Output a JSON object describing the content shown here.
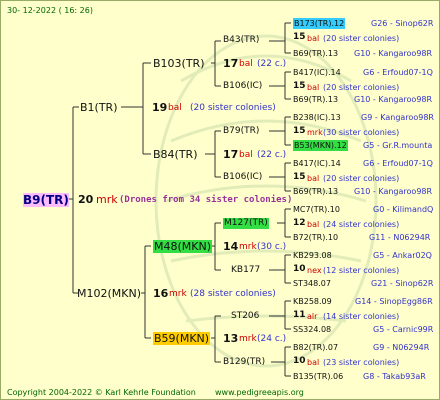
{
  "header": {
    "date": "30- 12-2022 ( 16: 26)"
  },
  "footer": {
    "copyright": "Copyright 2004-2022 © Karl Kehrle Foundation",
    "site": "www.pedigreeapis.org"
  },
  "colors": {
    "background": "#ffffcc",
    "highlight_cyan": "#33ccff",
    "highlight_green": "#33dd44",
    "highlight_yellow": "#ffcc00",
    "highlight_pink": "#ffbbff"
  },
  "root": {
    "name": "B9(TR)",
    "drones_count": "20",
    "drones_unit": "mrk",
    "drones_note": "(Drones from 34 sister colonies)"
  },
  "gen2": [
    {
      "name": "B1(TR)",
      "count": "19",
      "unit": "bal",
      "note": "(20 sister colonies)"
    },
    {
      "name": "M102(MKN)",
      "count": "16",
      "unit": "mrk",
      "note": "(28 sister colonies)"
    }
  ],
  "gen3": [
    {
      "name": "B103(TR)",
      "count": "17",
      "unit": "bal",
      "note": "(22 c.)",
      "mother": "B43(TR)",
      "father": "B106(IC)"
    },
    {
      "name": "B84(TR)",
      "count": "17",
      "unit": "bal",
      "note": "(22 c.)",
      "mother": "B79(TR)",
      "father": "B106(IC)"
    },
    {
      "name": "M48(MKN)",
      "count": "14",
      "unit": "mrk",
      "note": "(30 c.)",
      "mother": "M127(TR)",
      "father": "KB177"
    },
    {
      "name": "B59(MKN)",
      "count": "13",
      "unit": "mrk",
      "note": "(24 c.)",
      "mother": "ST206",
      "father": "B129(TR)"
    }
  ],
  "gen5": [
    {
      "queen": "B173(TR).12",
      "info": "G26 - Sinop62R",
      "count": "15",
      "unit": "bal",
      "note": "(20 sister colonies)",
      "drone": "B69(TR).13",
      "drone_info": "G10 - Kangaroo98R"
    },
    {
      "queen": "B417(IC).14",
      "info": "G6 - Erfoud07-1Q",
      "count": "15",
      "unit": "bal",
      "note": "(20 sister colonies)",
      "drone": "B69(TR).13",
      "drone_info": "G10 - Kangaroo98R"
    },
    {
      "queen": "B238(IC).13",
      "info": "G9 - Kangaroo98R",
      "count": "15",
      "unit": "mrk",
      "note": "(30 sister colonies)",
      "drone": "B53(MKN).12",
      "drone_info": "G5 - Gr.R.mounta"
    },
    {
      "queen": "B417(IC).14",
      "info": "G6 - Erfoud07-1Q",
      "count": "15",
      "unit": "bal",
      "note": "(20 sister colonies)",
      "drone": "B69(TR).13",
      "drone_info": "G10 - Kangaroo98R"
    },
    {
      "queen": "MC7(TR).10",
      "info": "G0 - KilimandQ",
      "count": "12",
      "unit": "bal",
      "note": "(24 sister colonies)",
      "drone": "B72(TR).10",
      "drone_info": "G11 - N06294R"
    },
    {
      "queen": "KB293.08",
      "info": "G5 - Ankar02Q",
      "count": "10",
      "unit": "nex",
      "note": "(12 sister colonies)",
      "drone": "ST348.07",
      "drone_info": "G21 - Sinop62R"
    },
    {
      "queen": "KB258.09",
      "info": "G14 - SinopEgg86R",
      "count": "11",
      "unit": "alr",
      "note": "(14 sister colonies)",
      "drone": "SS324.08",
      "drone_info": "G5 - Carnic99R"
    },
    {
      "queen": "B82(TR).07",
      "info": "G9 - N06294R",
      "count": "10",
      "unit": "bal",
      "note": "(23 sister colonies)",
      "drone": "B135(TR).06",
      "drone_info": "G8 - Takab93aR"
    }
  ]
}
